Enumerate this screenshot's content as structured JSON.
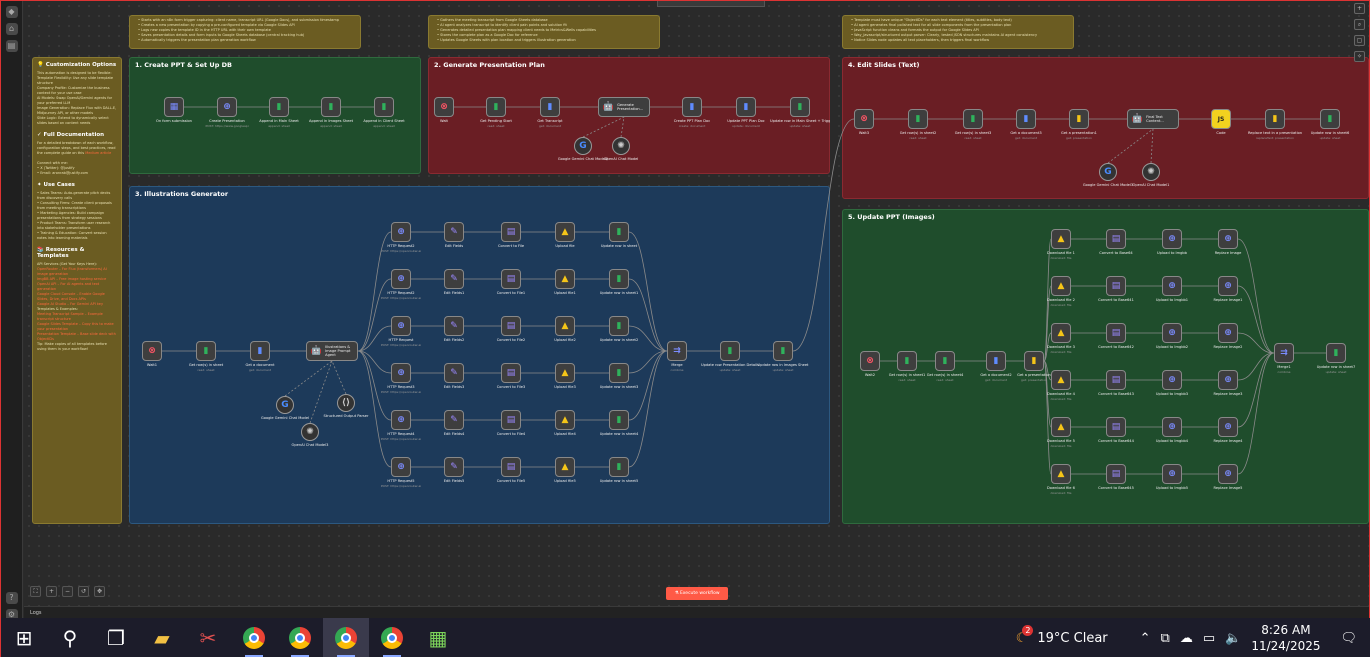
{
  "notes": {
    "top_left": [
      "Starts with an n8n form trigger capturing: client name, transcript URL (Google Docs), and submission timestamp",
      "Creates a new presentation by copying a pre-configured template via Google Slides API",
      "Logs new copies the template ID in the HTTP URL with their own template",
      "Saves presentation details and form inputs to Google Sheets database (central tracking hub)",
      "Automatically triggers the presentation plan generation workflow"
    ],
    "top_mid": [
      "Gathers the meeting transcript from Google Sheets database",
      "AI agent analyzes transcript to identify client pain points and solution fit",
      "Generates detailed presentation plan mapping client needs to Metrics&Wells capabilities",
      "Stores the complete plan as a Google Doc for reference",
      "Updates Google Sheets with plan location and triggers illustration generation"
    ],
    "top_right": [
      "Template must have unique \"ObjectIDs\" for each text element (titles, subtitles, body text)",
      "AI agent generates final polished text for all slide components from the presentation plan",
      "JavaScript function cleans and formats the output for Google Slides API",
      "Way_Javascript/structured output parser: Clearly, tested JSON structures maintains AI agent consistency",
      "Notice Slides node updates all text placeholders, then triggers final workflow"
    ]
  },
  "sidebar_note": {
    "h_custom": "Customization Options",
    "custom_lines": [
      "This automation is designed to be flexible:",
      "Template Flexibility: Use any slide template structure",
      "Company Profile: Customize the business context for your use case",
      "AI Models: Swap OpenAI/Gemini agents for your preferred LLM",
      "Image Generation: Replace Flux with DALL-E, Midjourney API, or other models",
      "Slide Logic: Extend to dynamically select slides based on content needs"
    ],
    "h_docs": "Full Documentation",
    "docs_lines": [
      "For a detailed breakdown of each workflow, configuration steps, and best practices, read the complete guide on this",
      "Connect with me:",
      "X (Twitter): @justify",
      "Email: aronrab@justify.com"
    ],
    "docs_link": "Medium article",
    "h_use": "Use Cases",
    "use_lines": [
      "Sales Teams: Auto-generate pitch decks from discovery calls",
      "Consulting Firms: Create client proposals from meeting transcriptions",
      "Marketing Agencies: Build campaign presentations from strategy sessions",
      "Product Teams: Transform user research into stakeholder presentations",
      "Training & Education: Convert session notes into learning materials"
    ],
    "h_res": "Resources & Templates",
    "res_lines": [
      "API Services (Get Your Keys Here):",
      "OpenRouter – For Flux (transformers) AI image generation",
      "ImgBB API – Free image hosting service",
      "OpenAI API – For AI agents and text generation",
      "Google Cloud Console – Enable Google Slides, Drive, and Docs APIs",
      "Google AI Studio – For Gemini API key",
      "Templates & Examples:",
      "Meeting Transcript Sample – Example transcript structure",
      "Google Slides Template – Copy this to make your presentation",
      "Presentation Template – Base slide deck with ObjectIDs",
      "Tip: Make copies of all templates before using them in your workflow!"
    ]
  },
  "sections": {
    "s1": "1. Create PPT & Set Up DB",
    "s2": "2. Generate Presentation Plan",
    "s3": "3. Illustrations Generator",
    "s4": "4. Edit Slides (Text)",
    "s5": "5. Update PPT (Images)"
  },
  "s1_nodes": [
    {
      "label": "On form submission",
      "sub": "",
      "icon": "form-icon"
    },
    {
      "label": "Create Presentation",
      "sub": "POST: https://www.googleapi",
      "icon": "http-icon"
    },
    {
      "label": "Append in Main Sheet",
      "sub": "append: sheet",
      "icon": "sheet-icon"
    },
    {
      "label": "Append in Images Sheet",
      "sub": "append: sheet",
      "icon": "sheet-icon"
    },
    {
      "label": "Append in Client Sheet",
      "sub": "append: sheet",
      "icon": "sheet-icon"
    }
  ],
  "s2_nodes": [
    {
      "label": "Wait",
      "sub": "",
      "icon": "wait-icon"
    },
    {
      "label": "Get Pending Start",
      "sub": "read: sheet",
      "icon": "sheet-icon"
    },
    {
      "label": "Get Transcript",
      "sub": "get: document",
      "icon": "doc-icon"
    },
    {
      "label": "Generate Presentation...",
      "sub": "",
      "icon": "agent-icon"
    },
    {
      "label": "Create PPT Plan Doc",
      "sub": "create: document",
      "icon": "doc-icon"
    },
    {
      "label": "Update PPT Plan Doc",
      "sub": "update: document",
      "icon": "doc-icon"
    },
    {
      "label": "Update row in Main Sheet + Trigger Image",
      "sub": "update: sheet",
      "icon": "sheet-icon"
    }
  ],
  "s2_models": [
    "Google Gemini Chat Model2",
    "OpenAI Chat Model"
  ],
  "s3_main": [
    {
      "label": "Wait1",
      "sub": "",
      "icon": "wait-icon"
    },
    {
      "label": "Get row(s) in sheet",
      "sub": "read: sheet",
      "icon": "sheet-icon"
    },
    {
      "label": "Get a document",
      "sub": "get: document",
      "icon": "doc-icon"
    },
    {
      "label": "Illustrations & Image Prompt Agent",
      "sub": "",
      "icon": "agent-icon"
    }
  ],
  "s3_models": [
    "Google Gemini Chat Model",
    "Structured Output Parser",
    "OpenAI Chat Model3"
  ],
  "s3_rows": [
    [
      "HTTP Request2",
      "Edit Fields",
      "Convert to File",
      "Upload file",
      "Update row in sheet"
    ],
    [
      "HTTP Request2",
      "Edit Fields1",
      "Convert to File1",
      "Upload file1",
      "Update row in sheet1"
    ],
    [
      "HTTP Request",
      "Edit Fields2",
      "Convert to File2",
      "Upload file2",
      "Update row in sheet2"
    ],
    [
      "HTTP Request3",
      "Edit Fields3",
      "Convert to File3",
      "Upload file3",
      "Update row in sheet3"
    ],
    [
      "HTTP Request4",
      "Edit Fields4",
      "Convert to File4",
      "Upload file4",
      "Update row in sheet4"
    ],
    [
      "HTTP Request5",
      "Edit Fields5",
      "Convert to File5",
      "Upload file5",
      "Update row in sheet5"
    ]
  ],
  "s3_tail": [
    {
      "label": "Merge",
      "sub": "combine",
      "icon": "merge-icon"
    },
    {
      "label": "Update row Presentation Details",
      "sub": "update: sheet",
      "icon": "sheet-icon"
    },
    {
      "label": "Update row in Images Sheet",
      "sub": "update: sheet",
      "icon": "sheet-icon"
    }
  ],
  "s4_nodes": [
    {
      "label": "Wait3",
      "sub": "",
      "icon": "wait-icon"
    },
    {
      "label": "Get row(s) in sheet2",
      "sub": "read: sheet",
      "icon": "sheet-icon"
    },
    {
      "label": "Get row(s) in sheet3",
      "sub": "read: sheet",
      "icon": "sheet-icon"
    },
    {
      "label": "Get a document3",
      "sub": "get: document",
      "icon": "doc-icon"
    },
    {
      "label": "Get a presentation1",
      "sub": "get: presentation",
      "icon": "slides-icon"
    },
    {
      "label": "Final Text Content...",
      "sub": "",
      "icon": "agent-icon"
    },
    {
      "label": "Code",
      "sub": "",
      "icon": "js-icon"
    },
    {
      "label": "Replace text in a presentation",
      "sub": "replaceText: presentation",
      "icon": "slides-icon"
    },
    {
      "label": "Update row in sheet6",
      "sub": "update: sheet",
      "icon": "sheet-icon"
    }
  ],
  "s4_models": [
    "Google Gemini Chat Model3",
    "OpenAI Chat Model1"
  ],
  "s5_main": [
    {
      "label": "Wait2",
      "sub": "",
      "icon": "wait-icon"
    },
    {
      "label": "Get row(s) in sheet1",
      "sub": "read: sheet",
      "icon": "sheet-icon"
    },
    {
      "label": "Get row(s) in sheet4",
      "sub": "read: sheet",
      "icon": "sheet-icon"
    },
    {
      "label": "Get a document2",
      "sub": "get: document",
      "icon": "doc-icon"
    },
    {
      "label": "Get a presentation",
      "sub": "get: presentation",
      "icon": "slides-icon"
    }
  ],
  "s5_rows": [
    [
      "Download file 1",
      "Convert to Base64",
      "Upload to Imgbb",
      "Replace Image"
    ],
    [
      "Download file 2",
      "Convert to Base641",
      "Upload to Imgbb1",
      "Replace Image1"
    ],
    [
      "Download file 3",
      "Convert to Base642",
      "Upload to Imgbb2",
      "Replace Image2"
    ],
    [
      "Download file 4",
      "Convert to Base643",
      "Upload to Imgbb3",
      "Replace Image3"
    ],
    [
      "Download file 5",
      "Convert to Base644",
      "Upload to Imgbb4",
      "Replace Image4"
    ],
    [
      "Download file 6",
      "Convert to Base645",
      "Upload to Imgbb5",
      "Replace Image5"
    ]
  ],
  "s5_tail": [
    {
      "label": "Merge1",
      "sub": "combine",
      "icon": "merge-icon"
    },
    {
      "label": "Update row in sheet7",
      "sub": "update: sheet",
      "icon": "sheet-icon"
    }
  ],
  "exec_button": "Execute workflow",
  "logs_label": "Logs",
  "tray": {
    "weather": "19°C  Clear",
    "time": "8:26 AM",
    "date": "11/24/2025",
    "badge": "2"
  },
  "colors": {
    "accent": "#ff5a46",
    "sheet": "#2fb25c",
    "http": "#7b8cff",
    "wait": "#ff5566"
  }
}
